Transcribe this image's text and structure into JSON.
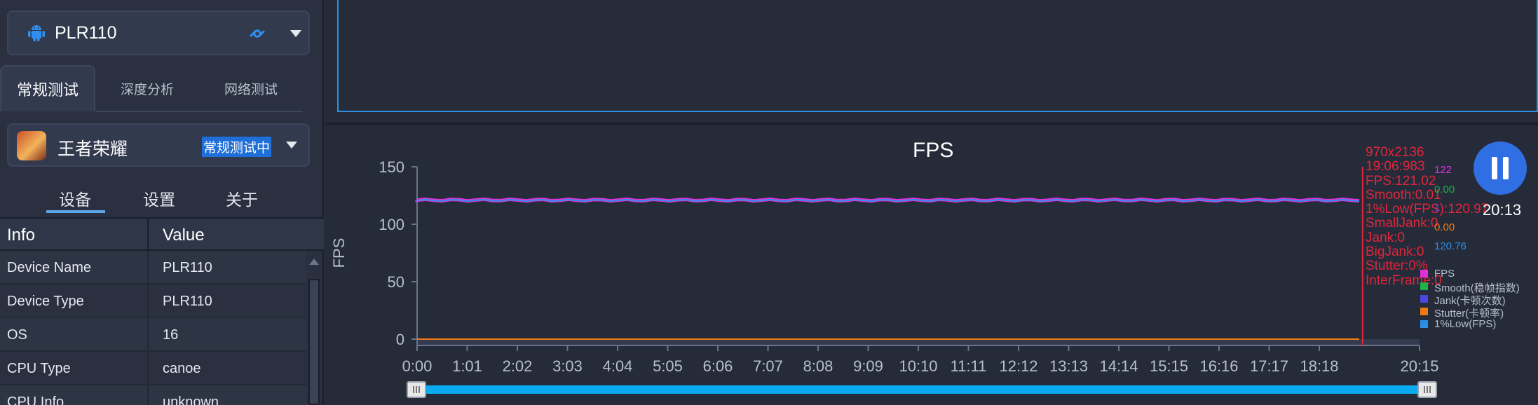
{
  "device": {
    "name": "PLR110"
  },
  "tabs": [
    {
      "label": "常规测试",
      "active": true
    },
    {
      "label": "深度分析",
      "active": false
    },
    {
      "label": "网络测试",
      "active": false
    }
  ],
  "game": {
    "name": "王者荣耀",
    "status": "常规测试中"
  },
  "subtabs": [
    {
      "label": "设备",
      "active": true
    },
    {
      "label": "设置",
      "active": false
    },
    {
      "label": "关于",
      "active": false
    }
  ],
  "info_table": {
    "headers": [
      "Info",
      "Value"
    ],
    "rows": [
      {
        "key": "Device Name",
        "value": "PLR110"
      },
      {
        "key": "Device Type",
        "value": "PLR110"
      },
      {
        "key": "OS",
        "value": "16"
      },
      {
        "key": "CPU Type",
        "value": "canoe"
      },
      {
        "key": "CPU Info",
        "value": "unknown"
      }
    ]
  },
  "clock": "20:13",
  "colors": {
    "fps": "#e030d8",
    "smooth": "#22b04a",
    "jank": "#4a48e0",
    "stutter": "#f07a10",
    "low1": "#2b8fe8",
    "accent": "#2f6fe3"
  },
  "chart_data": {
    "type": "line",
    "title": "FPS",
    "ylabel": "FPS",
    "ylim": [
      0,
      150
    ],
    "yticks": [
      "0",
      "50",
      "100",
      "150"
    ],
    "xticks": [
      "0:00",
      "1:01",
      "2:02",
      "3:03",
      "4:04",
      "5:05",
      "6:06",
      "7:07",
      "8:08",
      "9:09",
      "10:10",
      "11:11",
      "12:12",
      "13:13",
      "14:14",
      "15:15",
      "16:16",
      "17:17",
      "18:18",
      "20:15"
    ],
    "x_range_seconds": [
      0,
      1215
    ],
    "series": [
      {
        "name": "FPS",
        "values_approx": 121,
        "color": "#e030d8"
      },
      {
        "name": "Smooth(稳帧指数)",
        "values_approx": 0,
        "color": "#22b04a"
      },
      {
        "name": "Jank(卡顿次数)",
        "values_approx": 0,
        "color": "#4a48e0"
      },
      {
        "name": "Stutter(卡顿率)",
        "values_approx": 0,
        "color": "#f07a10"
      },
      {
        "name": "1%Low(FPS)",
        "values_approx": 120.76,
        "color": "#2b8fe8"
      }
    ],
    "cursor_time_seconds": 1146,
    "cursor_info": [
      "970x2136",
      "19:06:983",
      "FPS:121.02",
      "Smooth:0.01",
      "1%Low(FPS):120.97",
      "SmallJank:0",
      "Jank:0",
      "BigJank:0",
      "Stutter:0%",
      "InterFrame:0"
    ],
    "cursor_values": [
      {
        "label": "122",
        "color": "#e030d8"
      },
      {
        "label": "0.00",
        "color": "#22b04a"
      },
      {
        "label": "1",
        "color": "#4a48e0"
      },
      {
        "label": "0.00",
        "color": "#f07a10"
      },
      {
        "label": "120.76",
        "color": "#2b8fe8"
      }
    ]
  }
}
